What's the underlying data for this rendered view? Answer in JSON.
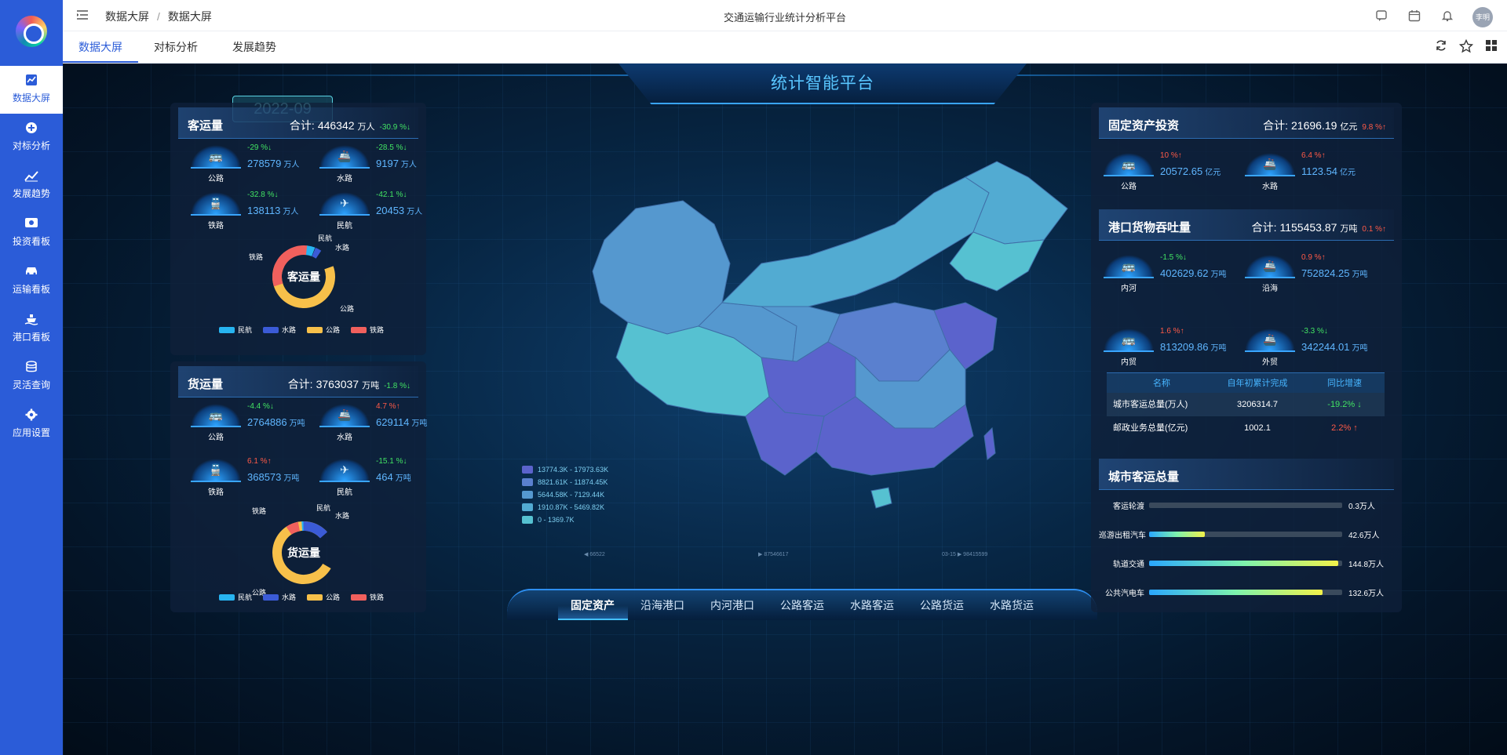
{
  "sidebar": {
    "items": [
      {
        "label": "数据大屏",
        "icon": "chart-icon"
      },
      {
        "label": "对标分析",
        "icon": "compass-icon"
      },
      {
        "label": "发展趋势",
        "icon": "trend-icon"
      },
      {
        "label": "投资看板",
        "icon": "money-icon"
      },
      {
        "label": "运输看板",
        "icon": "car-icon"
      },
      {
        "label": "港口看板",
        "icon": "ship-icon"
      },
      {
        "label": "灵活查询",
        "icon": "database-icon"
      },
      {
        "label": "应用设置",
        "icon": "gear-icon"
      }
    ]
  },
  "topbar": {
    "breadcrumb": [
      "数据大屏",
      "数据大屏"
    ],
    "title": "交通运输行业统计分析平台",
    "avatar": "李明"
  },
  "tabs": [
    "数据大屏",
    "对标分析",
    "发展趋势"
  ],
  "screen": {
    "title": "统计智能平台",
    "date": "2022-09"
  },
  "passenger": {
    "title": "客运量",
    "total_label": "合计:",
    "total": "446342",
    "unit": "万人",
    "change": "-30.9 %↓",
    "stats": [
      {
        "label": "公路",
        "change": "-29 %↓",
        "value": "278579",
        "unit": "万人",
        "dir": "down"
      },
      {
        "label": "水路",
        "change": "-28.5 %↓",
        "value": "9197",
        "unit": "万人",
        "dir": "down"
      },
      {
        "label": "铁路",
        "change": "-32.8 %↓",
        "value": "138113",
        "unit": "万人",
        "dir": "down"
      },
      {
        "label": "民航",
        "change": "-42.1 %↓",
        "value": "20453",
        "unit": "万人",
        "dir": "down"
      }
    ],
    "donut_center": "客运量",
    "donut_labels": [
      "民航",
      "水路",
      "公路",
      "铁路"
    ],
    "legend": [
      "民航",
      "水路",
      "公路",
      "铁路"
    ]
  },
  "freight": {
    "title": "货运量",
    "total_label": "合计:",
    "total": "3763037",
    "unit": "万吨",
    "change": "-1.8 %↓",
    "stats": [
      {
        "label": "公路",
        "change": "-4.4 %↓",
        "value": "2764886",
        "unit": "万吨",
        "dir": "down"
      },
      {
        "label": "水路",
        "change": "4.7 %↑",
        "value": "629114",
        "unit": "万吨",
        "dir": "up"
      },
      {
        "label": "铁路",
        "change": "6.1 %↑",
        "value": "368573",
        "unit": "万吨",
        "dir": "up"
      },
      {
        "label": "民航",
        "change": "-15.1 %↓",
        "value": "464",
        "unit": "万吨",
        "dir": "down"
      }
    ],
    "donut_center": "货运量",
    "donut_labels": [
      "铁路",
      "民航",
      "水路",
      "公路"
    ],
    "legend": [
      "民航",
      "水路",
      "公路",
      "铁路"
    ]
  },
  "map": {
    "legend": [
      {
        "range": "13774.3K - 17973.63K",
        "color": "#5b63cc"
      },
      {
        "range": "8821.61K - 11874.45K",
        "color": "#5a80cf"
      },
      {
        "range": "5644.58K - 7129.44K",
        "color": "#5598cf"
      },
      {
        "range": "1910.87K - 5469.82K",
        "color": "#52abd2"
      },
      {
        "range": "0 - 1369.7K",
        "color": "#56c1d1"
      }
    ],
    "readouts": [
      "◀ 66522",
      "▶ 87546617",
      "03-15 ▶ 98415599"
    ]
  },
  "bottom_tabs": [
    "固定资产",
    "沿海港口",
    "内河港口",
    "公路客运",
    "水路客运",
    "公路货运",
    "水路货运"
  ],
  "investment": {
    "title": "固定资产投资",
    "total_label": "合计:",
    "total": "21696.19",
    "unit": "亿元",
    "change": "9.8 %↑",
    "stats": [
      {
        "label": "公路",
        "change": "10 %↑",
        "value": "20572.65",
        "unit": "亿元",
        "dir": "up"
      },
      {
        "label": "水路",
        "change": "6.4 %↑",
        "value": "1123.54",
        "unit": "亿元",
        "dir": "up"
      }
    ]
  },
  "port": {
    "title": "港口货物吞吐量",
    "total_label": "合计:",
    "total": "1155453.87",
    "unit": "万吨",
    "change": "0.1 %↑",
    "stats": [
      {
        "label": "内河",
        "change": "-1.5 %↓",
        "value": "402629.62",
        "unit": "万吨",
        "dir": "down"
      },
      {
        "label": "沿海",
        "change": "0.9 %↑",
        "value": "752824.25",
        "unit": "万吨",
        "dir": "up"
      },
      {
        "label": "内贸",
        "change": "1.6 %↑",
        "value": "813209.86",
        "unit": "万吨",
        "dir": "up"
      },
      {
        "label": "外贸",
        "change": "-3.3 %↓",
        "value": "342244.01",
        "unit": "万吨",
        "dir": "down"
      }
    ]
  },
  "summary_table": {
    "headers": [
      "名称",
      "自年初累计完成",
      "同比增速"
    ],
    "rows": [
      {
        "name": "城市客运总量(万人)",
        "value": "3206314.7",
        "growth": "-19.2% ↓",
        "dir": "down"
      },
      {
        "name": "邮政业务总量(亿元)",
        "value": "1002.1",
        "growth": "2.2% ↑",
        "dir": "up"
      }
    ]
  },
  "city_passenger": {
    "title": "城市客运总量",
    "bars": [
      {
        "name": "客运轮渡",
        "value": "0.3万人",
        "ratio": 0.002
      },
      {
        "name": "巡游出租汽车",
        "value": "42.6万人",
        "ratio": 0.29
      },
      {
        "name": "轨道交通",
        "value": "144.8万人",
        "ratio": 0.98
      },
      {
        "name": "公共汽电车",
        "value": "132.6万人",
        "ratio": 0.9
      }
    ]
  },
  "colors": {
    "sidebar": "#2b5cd8",
    "down": "#42e363",
    "up": "#ff5a47",
    "minhang": "#27b4f0",
    "shuilu": "#3b5bd6",
    "gonglu": "#f7c04a",
    "tielu": "#f0605d"
  }
}
